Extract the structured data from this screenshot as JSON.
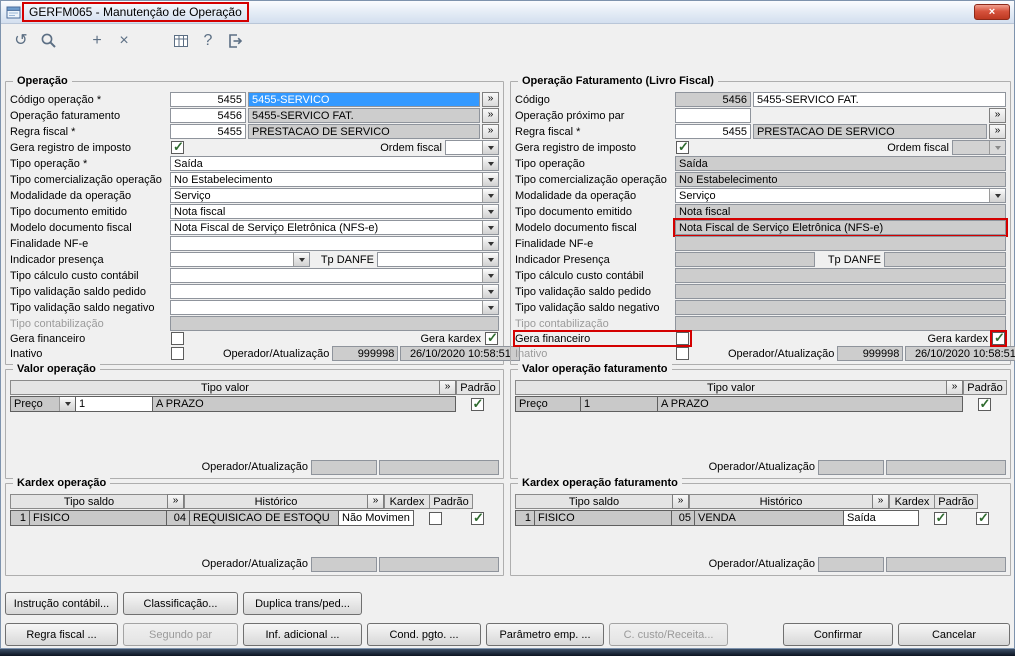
{
  "window": {
    "title": "GERFM065 - Manutenção de Operação",
    "close_glyph": "×"
  },
  "glyphs": {
    "more": "»"
  },
  "colors": {
    "selection": "#3399ff",
    "annotation": "#d40000",
    "readonly_field": "#cdcdcd",
    "close_button": "#bd3922"
  },
  "toolbar": {
    "icons": [
      {
        "name": "undo-icon",
        "glyph": "↺"
      },
      {
        "name": "search-icon",
        "glyph": ""
      },
      {
        "name": "add-icon",
        "glyph": "+"
      },
      {
        "name": "delete-icon",
        "glyph": "×"
      },
      {
        "name": "browse-grid-icon",
        "glyph": ""
      },
      {
        "name": "help-icon",
        "glyph": "?"
      },
      {
        "name": "exit-icon",
        "glyph": ""
      }
    ]
  },
  "operacao": {
    "legend": "Operação",
    "codigo_label": "Código operação *",
    "codigo_num": "5455",
    "codigo_desc": "5455-SERVICO",
    "faturamento_label": "Operação faturamento",
    "faturamento_num": "5456",
    "faturamento_desc": "5455-SERVICO FAT.",
    "regra_label": "Regra fiscal *",
    "regra_num": "5455",
    "regra_desc": "PRESTACAO DE SERVICO",
    "gera_imposto_label": "Gera registro de imposto",
    "ordem_fiscal_label": "Ordem fiscal",
    "tipo_operacao_label": "Tipo operação *",
    "tipo_operacao": "Saída",
    "tipo_comercializacao_label": "Tipo comercialização operação",
    "tipo_comercializacao": "No Estabelecimento",
    "modalidade_label": "Modalidade da operação",
    "modalidade": "Serviço",
    "tipo_documento_label": "Tipo documento emitido",
    "tipo_documento": "Nota fiscal",
    "modelo_label": "Modelo documento fiscal",
    "modelo": "Nota Fiscal de Serviço Eletrônica (NFS-e)",
    "finalidade_label": "Finalidade NF-e",
    "indicador_label": "Indicador presença",
    "tp_danfe_label": "Tp DANFE",
    "tipo_calculo_label": "Tipo cálculo custo contábil",
    "saldo_pedido_label": "Tipo validação saldo pedido",
    "saldo_negativo_label": "Tipo validação saldo negativo",
    "tipo_contabilizacao_label": "Tipo contabilização",
    "gera_financeiro_label": "Gera financeiro",
    "gera_kardex_label": "Gera kardex",
    "inativo_label": "Inativo",
    "operador_label": "Operador/Atualização",
    "operador_num": "999998",
    "operador_data": "26/10/2020 10:58:51"
  },
  "faturamento": {
    "legend": "Operação Faturamento (Livro Fiscal)",
    "codigo_label": "Código",
    "codigo_num": "5456",
    "codigo_desc": "5455-SERVICO FAT.",
    "proximo_par_label": "Operação próximo par",
    "regra_label": "Regra fiscal *",
    "regra_num": "5455",
    "regra_desc": "PRESTACAO DE SERVICO",
    "gera_imposto_label": "Gera registro de imposto",
    "ordem_fiscal_label": "Ordem fiscal",
    "tipo_operacao_label": "Tipo operação",
    "tipo_operacao": "Saída",
    "tipo_comercializacao_label": "Tipo comercialização operação",
    "tipo_comercializacao": "No Estabelecimento",
    "modalidade_label": "Modalidade da operação",
    "modalidade": "Serviço",
    "tipo_documento_label": "Tipo documento emitido",
    "tipo_documento": "Nota fiscal",
    "modelo_label": "Modelo documento fiscal",
    "modelo": "Nota Fiscal de Serviço Eletrônica (NFS-e)",
    "finalidade_label": "Finalidade NF-e",
    "indicador_label": "Indicador Presença",
    "tp_danfe_label": "Tp DANFE",
    "tipo_calculo_label": "Tipo cálculo custo contábil",
    "saldo_pedido_label": "Tipo validação saldo pedido",
    "saldo_negativo_label": "Tipo validação saldo negativo",
    "tipo_contabilizacao_label": "Tipo contabilização",
    "gera_financeiro_label": "Gera financeiro",
    "gera_kardex_label": "Gera kardex",
    "inativo_label": "Inativo",
    "operador_label": "Operador/Atualização",
    "operador_num": "999998",
    "operador_data": "26/10/2020 10:58:51"
  },
  "valor_operacao": {
    "legend": "Valor operação",
    "header_tipo_valor": "Tipo valor",
    "header_padrao": "Padrão",
    "tipo": "Preço",
    "sequencia": "1",
    "descricao": "A PRAZO",
    "operador_label": "Operador/Atualização"
  },
  "valor_faturamento": {
    "legend": "Valor operação faturamento",
    "header_tipo_valor": "Tipo valor",
    "header_padrao": "Padrão",
    "tipo": "Preço",
    "sequencia": "1",
    "descricao": "A PRAZO",
    "operador_label": "Operador/Atualização"
  },
  "kardex_operacao": {
    "legend": "Kardex operação",
    "header_tipo_saldo": "Tipo saldo",
    "header_historico": "Histórico",
    "header_kardex": "Kardex",
    "header_padrao": "Padrão",
    "saldo_num": "1",
    "saldo_desc": "FISICO",
    "historico_num": "04",
    "historico_desc": "REQUISICAO DE ESTOQU",
    "movimento": "Não Movimen",
    "operador_label": "Operador/Atualização"
  },
  "kardex_faturamento": {
    "legend": "Kardex operação faturamento",
    "header_tipo_saldo": "Tipo saldo",
    "header_historico": "Histórico",
    "header_kardex": "Kardex",
    "header_padrao": "Padrão",
    "saldo_num": "1",
    "saldo_desc": "FISICO",
    "historico_num": "05",
    "historico_desc": "VENDA",
    "movimento": "Saída",
    "operador_label": "Operador/Atualização"
  },
  "buttons": {
    "instrucao_contabil": "Instrução contábil...",
    "classificacao": "Classificação...",
    "duplica": "Duplica trans/ped...",
    "regra_fiscal": "Regra fiscal ...",
    "segundo_par": "Segundo par",
    "inf_adicional": "Inf. adicional ...",
    "cond_pgto": "Cond. pgto. ...",
    "parametro_emp": "Parâmetro emp. ...",
    "c_custo": "C. custo/Receita...",
    "confirmar": "Confirmar",
    "cancelar": "Cancelar"
  }
}
